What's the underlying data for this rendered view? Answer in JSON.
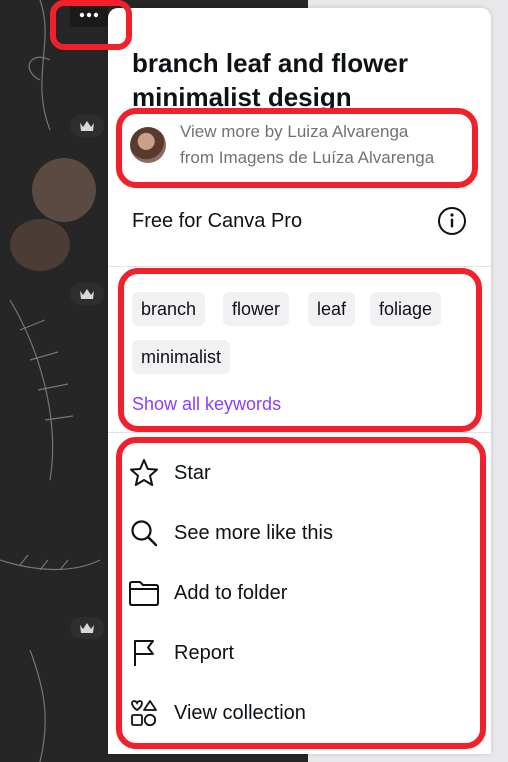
{
  "panel": {
    "title": "branch leaf and flower minimalist design",
    "author": {
      "line1": "View more by Luiza Alvarenga",
      "line2": "from Imagens de Luíza Alvarenga"
    },
    "license": "Free for Canva Pro",
    "keywords": [
      "branch",
      "flower",
      "leaf",
      "foliage",
      "minimalist"
    ],
    "show_all_keywords": "Show all keywords",
    "menu": [
      {
        "label": "Star",
        "icon": "star-icon"
      },
      {
        "label": "See more like this",
        "icon": "search-icon"
      },
      {
        "label": "Add to folder",
        "icon": "folder-icon"
      },
      {
        "label": "Report",
        "icon": "flag-icon"
      },
      {
        "label": "View collection",
        "icon": "shapes-icon"
      }
    ]
  },
  "colors": {
    "accent": "#8b3dff",
    "highlight": "#f0212b",
    "background_dark": "#262626"
  }
}
